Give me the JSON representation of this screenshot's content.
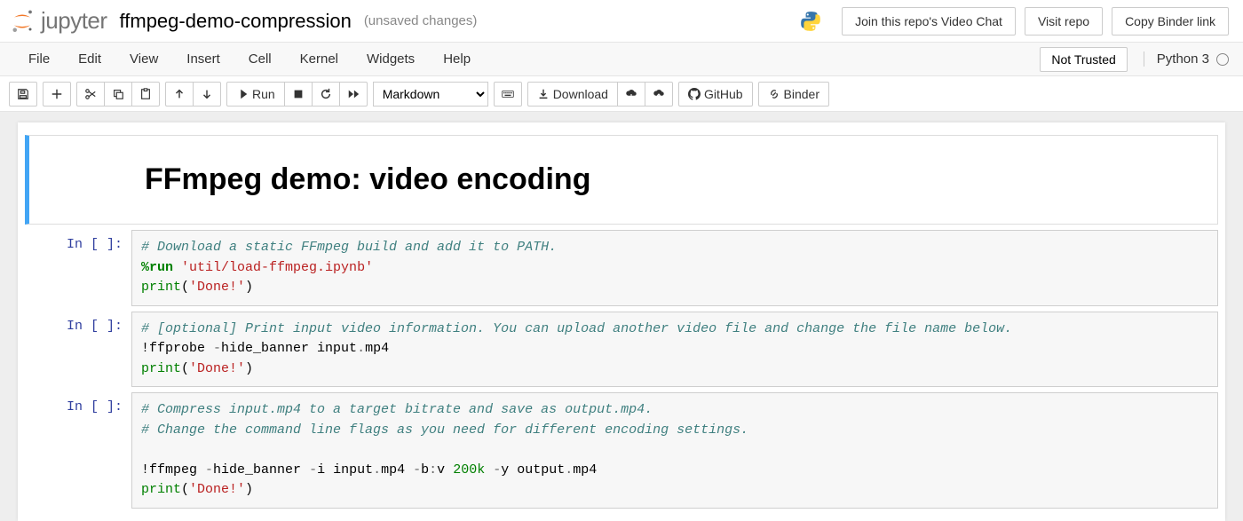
{
  "header": {
    "logo_text": "jupyter",
    "notebook_name": "ffmpeg-demo-compression",
    "save_status": "(unsaved changes)",
    "buttons": {
      "video_chat": "Join this repo's Video Chat",
      "visit_repo": "Visit repo",
      "copy_binder": "Copy Binder link"
    }
  },
  "menubar": {
    "items": [
      "File",
      "Edit",
      "View",
      "Insert",
      "Cell",
      "Kernel",
      "Widgets",
      "Help"
    ],
    "trust": "Not Trusted",
    "kernel": "Python 3"
  },
  "toolbar": {
    "run_label": "Run",
    "celltype": "Markdown",
    "download": "Download",
    "github": "GitHub",
    "binder": "Binder"
  },
  "cells": [
    {
      "type": "markdown",
      "heading": "FFmpeg demo: video encoding"
    },
    {
      "type": "code",
      "prompt": "In [ ]:",
      "lines": [
        {
          "segments": [
            {
              "cls": "c-comment",
              "text": "# Download a static FFmpeg build and add it to PATH."
            }
          ]
        },
        {
          "segments": [
            {
              "cls": "c-magic",
              "text": "%run"
            },
            {
              "cls": "",
              "text": " "
            },
            {
              "cls": "c-str",
              "text": "'util/load-ffmpeg.ipynb'"
            }
          ]
        },
        {
          "segments": [
            {
              "cls": "c-builtin",
              "text": "print"
            },
            {
              "cls": "",
              "text": "("
            },
            {
              "cls": "c-str",
              "text": "'Done!'"
            },
            {
              "cls": "",
              "text": ")"
            }
          ]
        }
      ]
    },
    {
      "type": "code",
      "prompt": "In [ ]:",
      "lines": [
        {
          "segments": [
            {
              "cls": "c-comment",
              "text": "# [optional] Print input video information. You can upload another video file and change the file name below."
            }
          ]
        },
        {
          "segments": [
            {
              "cls": "c-shell",
              "text": "!ffprobe "
            },
            {
              "cls": "c-op",
              "text": "-"
            },
            {
              "cls": "c-shell",
              "text": "hide_banner input"
            },
            {
              "cls": "c-op",
              "text": "."
            },
            {
              "cls": "c-shell",
              "text": "mp4"
            }
          ]
        },
        {
          "segments": [
            {
              "cls": "c-builtin",
              "text": "print"
            },
            {
              "cls": "",
              "text": "("
            },
            {
              "cls": "c-str",
              "text": "'Done!'"
            },
            {
              "cls": "",
              "text": ")"
            }
          ]
        }
      ]
    },
    {
      "type": "code",
      "prompt": "In [ ]:",
      "lines": [
        {
          "segments": [
            {
              "cls": "c-comment",
              "text": "# Compress input.mp4 to a target bitrate and save as output.mp4."
            }
          ]
        },
        {
          "segments": [
            {
              "cls": "c-comment",
              "text": "# Change the command line flags as you need for different encoding settings."
            }
          ]
        },
        {
          "segments": [
            {
              "cls": "",
              "text": ""
            }
          ]
        },
        {
          "segments": [
            {
              "cls": "c-shell",
              "text": "!ffmpeg "
            },
            {
              "cls": "c-op",
              "text": "-"
            },
            {
              "cls": "c-shell",
              "text": "hide_banner "
            },
            {
              "cls": "c-op",
              "text": "-"
            },
            {
              "cls": "c-shell",
              "text": "i input"
            },
            {
              "cls": "c-op",
              "text": "."
            },
            {
              "cls": "c-shell",
              "text": "mp4 "
            },
            {
              "cls": "c-op",
              "text": "-"
            },
            {
              "cls": "c-shell",
              "text": "b"
            },
            {
              "cls": "c-op",
              "text": ":"
            },
            {
              "cls": "c-shell",
              "text": "v "
            },
            {
              "cls": "c-num",
              "text": "200k"
            },
            {
              "cls": "c-shell",
              "text": " "
            },
            {
              "cls": "c-op",
              "text": "-"
            },
            {
              "cls": "c-shell",
              "text": "y output"
            },
            {
              "cls": "c-op",
              "text": "."
            },
            {
              "cls": "c-shell",
              "text": "mp4"
            }
          ]
        },
        {
          "segments": [
            {
              "cls": "c-builtin",
              "text": "print"
            },
            {
              "cls": "",
              "text": "("
            },
            {
              "cls": "c-str",
              "text": "'Done!'"
            },
            {
              "cls": "",
              "text": ")"
            }
          ]
        }
      ]
    }
  ]
}
